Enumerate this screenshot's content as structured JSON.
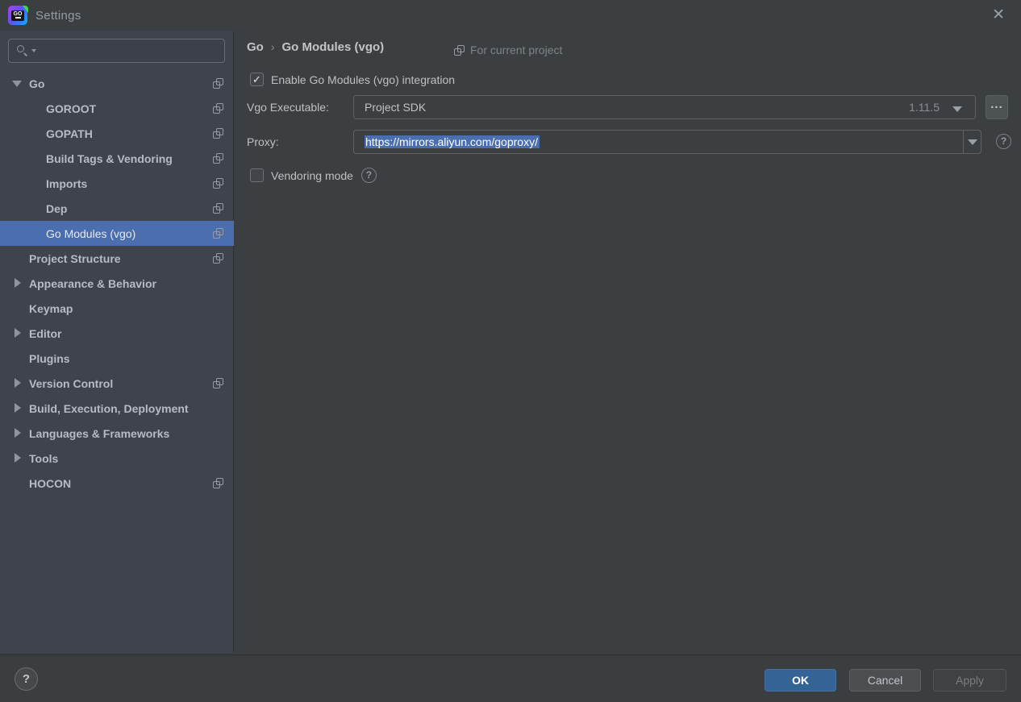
{
  "window": {
    "title": "Settings",
    "logo_text": "GO"
  },
  "icons": {
    "close": "✕",
    "check": "✓",
    "help": "?"
  },
  "colors": {
    "panel_bg": "#3c3f41",
    "sidebar_bg": "#3e434e",
    "selection_blue": "#4b6eaf",
    "ok_button_blue": "#346396",
    "field_border": "#5f6365",
    "tree_text": "#b7bcc2",
    "muted_text": "#7f8488"
  },
  "search": {
    "value": "",
    "placeholder": ""
  },
  "sidebar": {
    "items": [
      {
        "label": "Go",
        "level": 0,
        "state": "expanded",
        "project_icon": true,
        "selected": false
      },
      {
        "label": "GOROOT",
        "level": 1,
        "state": "none",
        "project_icon": true,
        "selected": false
      },
      {
        "label": "GOPATH",
        "level": 1,
        "state": "none",
        "project_icon": true,
        "selected": false
      },
      {
        "label": "Build Tags & Vendoring",
        "level": 1,
        "state": "none",
        "project_icon": true,
        "selected": false
      },
      {
        "label": "Imports",
        "level": 1,
        "state": "none",
        "project_icon": true,
        "selected": false
      },
      {
        "label": "Dep",
        "level": 1,
        "state": "none",
        "project_icon": true,
        "selected": false
      },
      {
        "label": "Go Modules (vgo)",
        "level": 1,
        "state": "none",
        "project_icon": true,
        "selected": true
      },
      {
        "label": "Project Structure",
        "level": 0,
        "state": "none",
        "project_icon": true,
        "selected": false
      },
      {
        "label": "Appearance & Behavior",
        "level": 0,
        "state": "collapsed",
        "project_icon": false,
        "selected": false
      },
      {
        "label": "Keymap",
        "level": 0,
        "state": "none",
        "project_icon": false,
        "selected": false
      },
      {
        "label": "Editor",
        "level": 0,
        "state": "collapsed",
        "project_icon": false,
        "selected": false
      },
      {
        "label": "Plugins",
        "level": 0,
        "state": "none",
        "project_icon": false,
        "selected": false
      },
      {
        "label": "Version Control",
        "level": 0,
        "state": "collapsed",
        "project_icon": true,
        "selected": false
      },
      {
        "label": "Build, Execution, Deployment",
        "level": 0,
        "state": "collapsed",
        "project_icon": false,
        "selected": false
      },
      {
        "label": "Languages & Frameworks",
        "level": 0,
        "state": "collapsed",
        "project_icon": false,
        "selected": false
      },
      {
        "label": "Tools",
        "level": 0,
        "state": "collapsed",
        "project_icon": false,
        "selected": false
      },
      {
        "label": "HOCON",
        "level": 0,
        "state": "none",
        "project_icon": true,
        "selected": false
      }
    ]
  },
  "content": {
    "breadcrumb": {
      "parent": "Go",
      "separator": "›",
      "current": "Go Modules (vgo)"
    },
    "scope_label": "For current project",
    "enable_checkbox": {
      "label": "Enable Go Modules (vgo) integration",
      "checked": true
    },
    "vgo_executable": {
      "label": "Vgo Executable:",
      "value": "Project SDK",
      "version": "1.11.5",
      "browse_label": "..."
    },
    "proxy": {
      "label": "Proxy:",
      "value": "https://mirrors.aliyun.com/goproxy/",
      "selected": true
    },
    "vendoring": {
      "label": "Vendoring mode",
      "checked": false
    }
  },
  "footer": {
    "help": "?",
    "ok_label": "OK",
    "cancel_label": "Cancel",
    "apply_label": "Apply"
  }
}
